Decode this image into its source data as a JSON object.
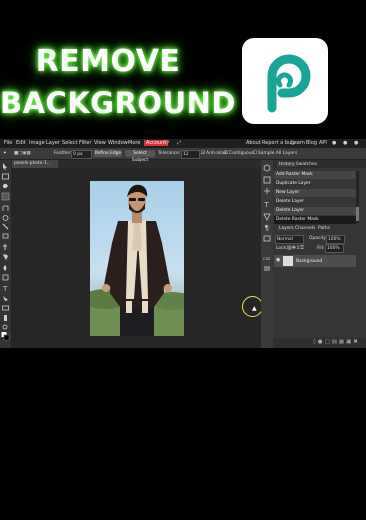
{
  "headline": {
    "line1": "REMOVE",
    "line2": "BACKGROUND"
  },
  "app_logo": {
    "icon": "photopea-logo-icon",
    "color": "#18a497"
  },
  "menu": [
    "File",
    "Edit",
    "Image",
    "Layer",
    "Select",
    "Filter",
    "View",
    "Window",
    "Account"
  ],
  "menu_right": [
    "About",
    "Report a bug",
    "Learn",
    "Blog",
    "API"
  ],
  "options": {
    "feather_label": "Feather:",
    "feather_value": "0 px",
    "refine_edge": "Refine Edge",
    "select_subject": "Select Subject",
    "tolerance_label": "Tolerance:",
    "tolerance_value": "12",
    "anti_alias": "Anti-alias",
    "contiguous": "Contiguous",
    "sample_all": "Sample All Layers"
  },
  "document_tab": "pexels-photo-1...",
  "history_panel": {
    "tabs": [
      "History",
      "Swatches"
    ],
    "items": [
      "Add Raster Mask",
      "Duplicate Layer",
      "New Layer",
      "Delete Layer",
      "Delete Layer",
      "Delete Raster Mask"
    ]
  },
  "layers_panel": {
    "tabs": [
      "Layers",
      "Channels",
      "Paths"
    ],
    "blend_mode": "Normal",
    "opacity_label": "Opacity:",
    "opacity_value": "100%",
    "lock_label": "Lock:",
    "fill_label": "Fill:",
    "fill_value": "100%",
    "layers": [
      {
        "name": "Background"
      }
    ]
  },
  "colors": {
    "accent_menu": "#d9303a",
    "glow": "#4fdc2f"
  }
}
